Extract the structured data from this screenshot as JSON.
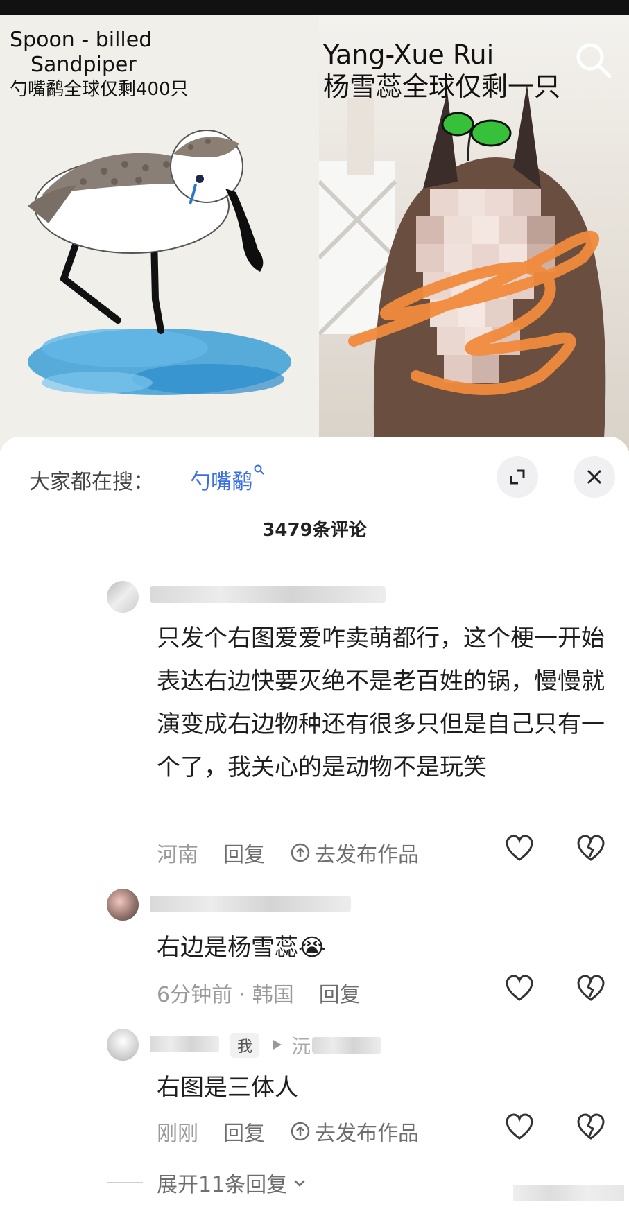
{
  "video": {
    "left_caption": {
      "line1": "Spoon - billed",
      "line2": "Sandpiper",
      "line3": "勺嘴鹬全球仅剩400只"
    },
    "right_caption": {
      "line1": "Yang-Xue Rui",
      "line2": "杨雪蕊全球仅剩一只"
    }
  },
  "search_bar": {
    "label": "大家都在搜：",
    "query": "勺嘴鹬"
  },
  "comments_header": {
    "count": "3479条评论"
  },
  "comments": [
    {
      "text": "只发个右图爱爱咋卖萌都行，这个梗一开始表达右边快要灭绝不是老百姓的锅，慢慢就演变成右边物种还有很多只但是自己只有一个了，我关心的是动物不是玩笑",
      "location": "河南",
      "reply": "回复",
      "publish": "去发布作品"
    },
    {
      "text": "右边是杨雪蕊",
      "emoji": "😭",
      "time_location": "6分钟前 · 韩国",
      "reply": "回复"
    },
    {
      "tag": "我",
      "username_partial": "沅",
      "text": "右图是三体人",
      "time": "刚刚",
      "reply": "回复",
      "publish": "去发布作品"
    }
  ],
  "expand_replies": "展开11条回复",
  "icons": [
    "search-icon",
    "expand-icon",
    "close-icon",
    "upload-icon",
    "heart-icon",
    "broken-heart-icon",
    "chevron-down-icon",
    "play-icon"
  ],
  "colors": {
    "link": "#3a6ee8",
    "meta": "#9a9a9a",
    "sketch_orange": "#f08a3c",
    "water": "#3b9fd6"
  }
}
